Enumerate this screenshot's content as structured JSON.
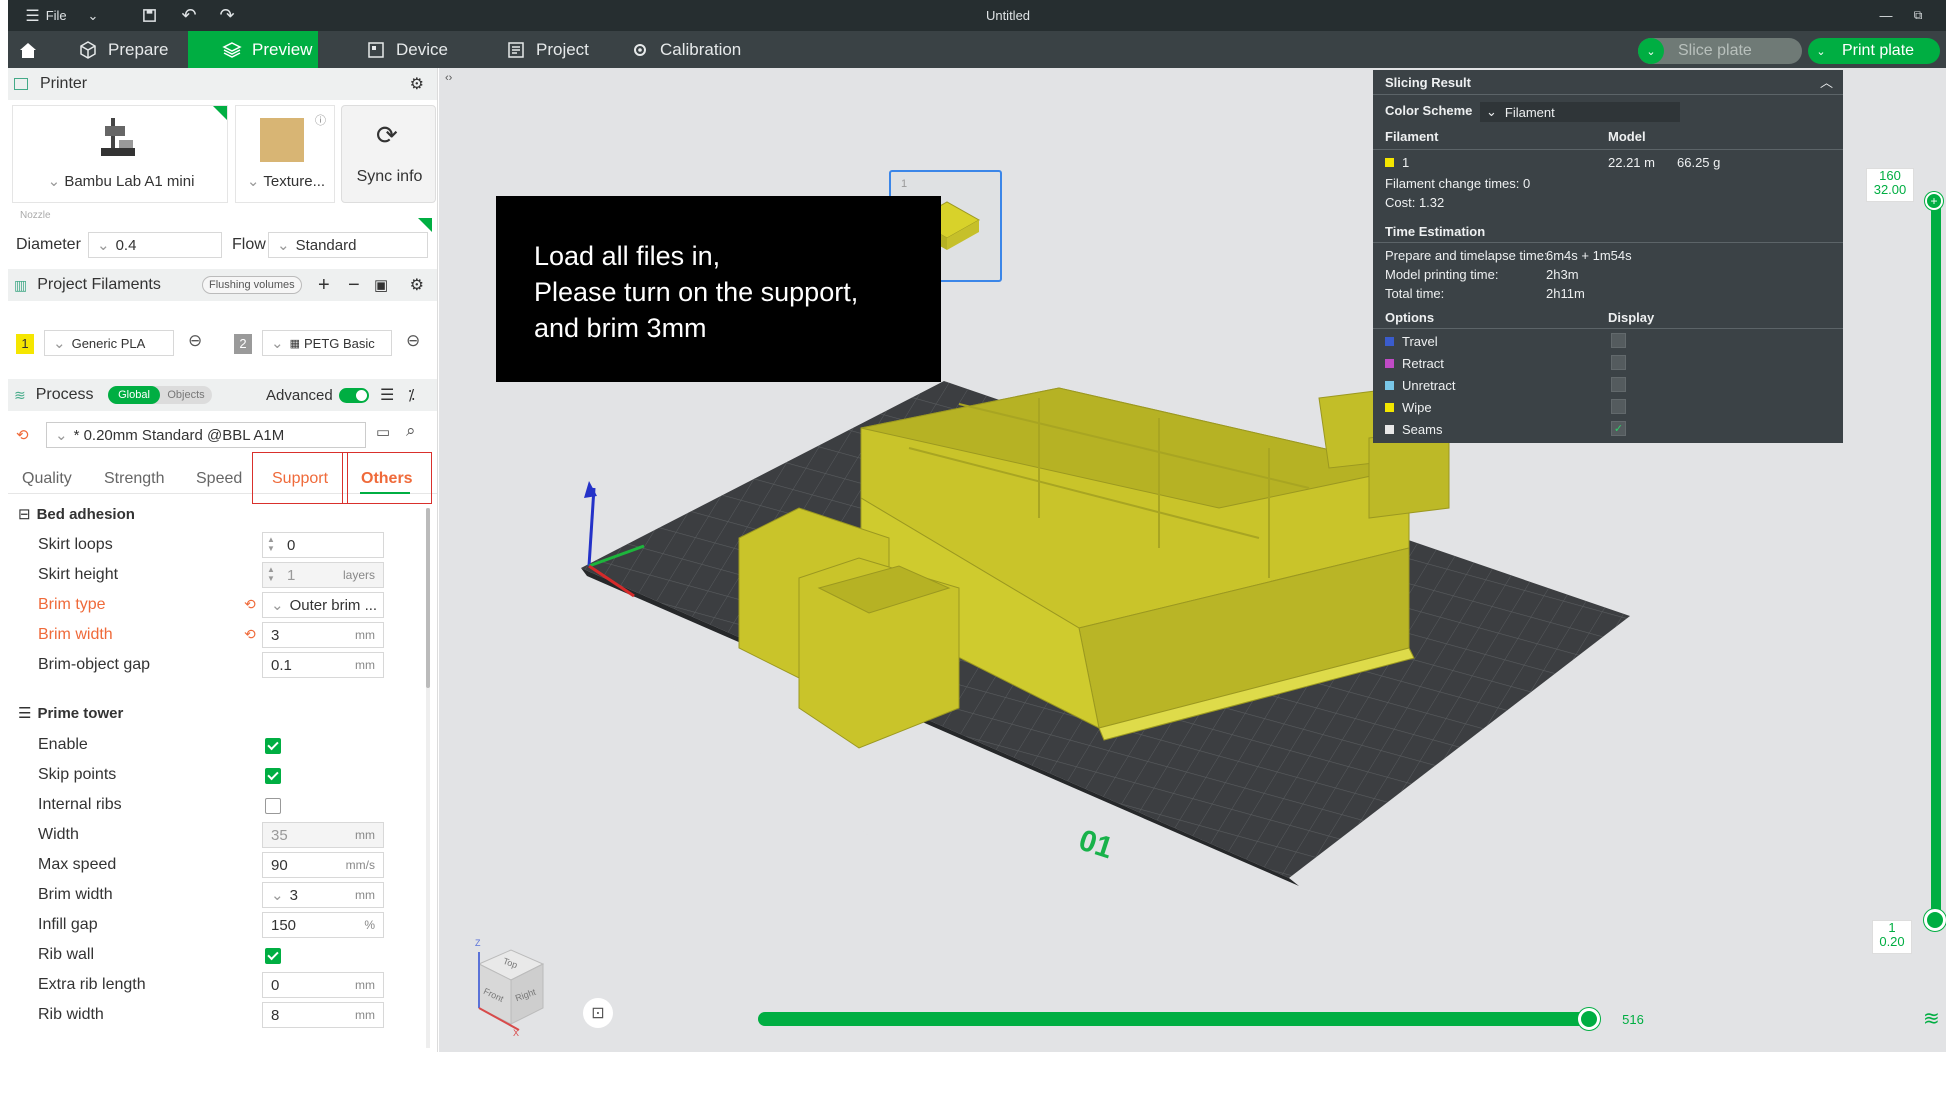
{
  "window": {
    "file_label": "File",
    "title": "Untitled"
  },
  "toolbar": {
    "tabs": [
      {
        "label": "Prepare",
        "icon": "cube-outline-icon",
        "active": false
      },
      {
        "label": "Preview",
        "icon": "layers-icon",
        "active": true
      },
      {
        "label": "Device",
        "icon": "device-icon",
        "active": false
      },
      {
        "label": "Project",
        "icon": "project-icon",
        "active": false
      },
      {
        "label": "Calibration",
        "icon": "calibration-icon",
        "active": false
      }
    ],
    "slice_label": "Slice plate",
    "print_label": "Print plate",
    "accent_color": "#00ae42"
  },
  "printer": {
    "section_title": "Printer",
    "printer_name": "Bambu Lab A1 mini",
    "plate_name": "Texture...",
    "sync_label": "Sync info",
    "nozzle_label": "Nozzle",
    "diameter_label": "Diameter",
    "diameter_value": "0.4",
    "flow_label": "Flow",
    "flow_value": "Standard"
  },
  "filaments": {
    "section_title": "Project Filaments",
    "flushing_label": "Flushing volumes",
    "items": [
      {
        "index": "1",
        "name": "Generic PLA",
        "color": "#f5e600"
      },
      {
        "index": "2",
        "name": "PETG Basic",
        "color": "#9a9a9a"
      }
    ]
  },
  "process": {
    "section_title": "Process",
    "global_label": "Global",
    "objects_label": "Objects",
    "advanced_label": "Advanced",
    "preset": "* 0.20mm Standard @BBL A1M",
    "tabs": [
      "Quality",
      "Strength",
      "Speed",
      "Support",
      "Others"
    ],
    "active_tab": "Others"
  },
  "bed_adhesion": {
    "title": "Bed adhesion",
    "rows": [
      {
        "label": "Skirt loops",
        "value": "0",
        "unit": ""
      },
      {
        "label": "Skirt height",
        "value": "1",
        "unit": "layers"
      },
      {
        "label": "Brim type",
        "value": "Outer brim ...",
        "unit": ""
      },
      {
        "label": "Brim width",
        "value": "3",
        "unit": "mm"
      },
      {
        "label": "Brim-object gap",
        "value": "0.1",
        "unit": "mm"
      }
    ]
  },
  "prime_tower": {
    "title": "Prime tower",
    "rows": [
      {
        "label": "Enable",
        "checked": true
      },
      {
        "label": "Skip points",
        "checked": true
      },
      {
        "label": "Internal ribs",
        "checked": false
      },
      {
        "label": "Width",
        "value": "35",
        "unit": "mm"
      },
      {
        "label": "Max speed",
        "value": "90",
        "unit": "mm/s"
      },
      {
        "label": "Brim width",
        "value": "3",
        "unit": "mm"
      },
      {
        "label": "Infill gap",
        "value": "150",
        "unit": "%"
      },
      {
        "label": "Rib wall",
        "checked": true
      },
      {
        "label": "Extra rib length",
        "value": "0",
        "unit": "mm"
      },
      {
        "label": "Rib width",
        "value": "8",
        "unit": "mm"
      }
    ]
  },
  "slicing_result": {
    "title": "Slicing Result",
    "color_scheme_label": "Color Scheme",
    "color_scheme_value": "Filament",
    "filament_header": "Filament",
    "model_header": "Model",
    "filament_index": "1",
    "model_length": "22.21 m",
    "model_weight": "66.25 g",
    "change_times": "Filament change times:  0",
    "cost": "Cost:  1.32",
    "time_header": "Time Estimation",
    "prepare_label": "Prepare and timelapse time:",
    "prepare_value": "6m4s + 1m54s",
    "printing_label": "Model printing time:",
    "printing_value": "2h3m",
    "total_label": "Total time:",
    "total_value": "2h11m",
    "options_header": "Options",
    "display_header": "Display",
    "options": [
      {
        "name": "Travel",
        "color": "#3a5ccc",
        "checked": false
      },
      {
        "name": "Retract",
        "color": "#c04bc6",
        "checked": false
      },
      {
        "name": "Unretract",
        "color": "#79c7e8",
        "checked": false
      },
      {
        "name": "Wipe",
        "color": "#f2e600",
        "checked": false
      },
      {
        "name": "Seams",
        "color": "#e8e8e8",
        "checked": true
      }
    ]
  },
  "overlay": {
    "lines": [
      "Load all files in,",
      "Please turn on the support,",
      "and brim 3mm"
    ]
  },
  "plate": {
    "number": "1",
    "label": "01"
  },
  "sliders": {
    "layer_top": "160",
    "height_top": "32.00",
    "layer_bottom": "1",
    "height_bottom": "0.20",
    "move_value": "516"
  },
  "view_cube": {
    "top": "Top",
    "front": "Front",
    "right": "Right",
    "z": "Z",
    "x": "X"
  }
}
